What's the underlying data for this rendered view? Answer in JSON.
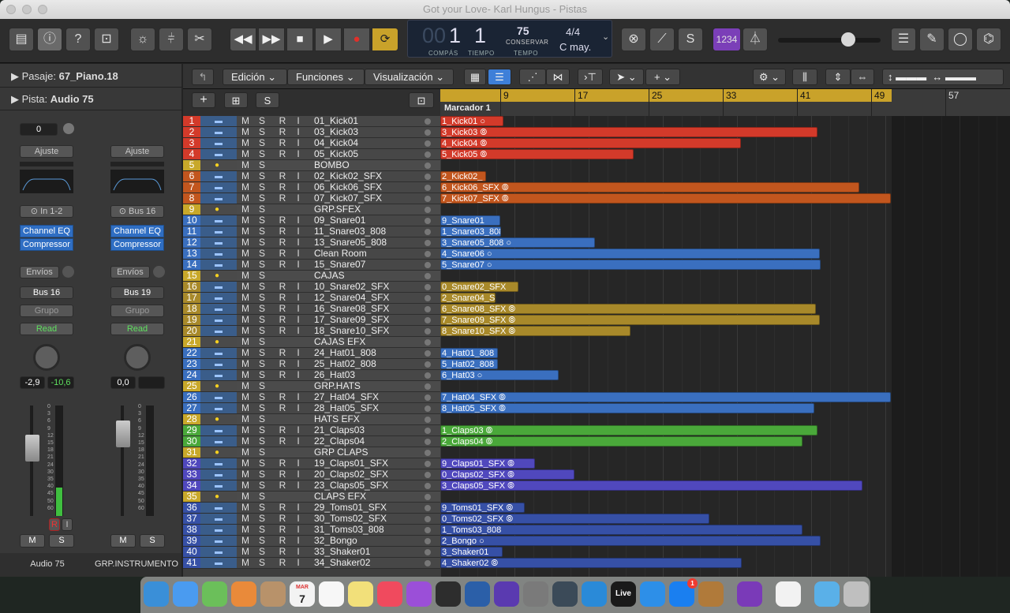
{
  "window": {
    "title": "Got your Love- Karl Hungus - Pistas"
  },
  "lcd": {
    "bar": "1",
    "beat": "1",
    "tempo": "75",
    "tempo_mode": "CONSERVAR",
    "sig": "4/4",
    "key": "C may.",
    "bar_label": "COMPÁS",
    "beat_label": "TIEMPO",
    "tempo_label": "TEMPO",
    "count_in": "1234"
  },
  "inspector": {
    "region_label": "Pasaje:",
    "region_name": "67_Piano.18",
    "track_label": "Pista:",
    "track_name": "Audio 75",
    "strip1": {
      "value": "0",
      "ajuste": "Ajuste",
      "input": "In 1-2",
      "plugin1": "Channel EQ",
      "plugin2": "Compressor",
      "envios": "Envíos",
      "bus": "Bus 16",
      "grupo": "Grupo",
      "read": "Read",
      "vol": "-2,9",
      "peak": "-10,6",
      "name": "Audio 75"
    },
    "strip2": {
      "ajuste": "Ajuste",
      "input": "Bus 16",
      "plugin1": "Channel EQ",
      "plugin2": "Compressor",
      "envios": "Envíos",
      "bus": "Bus 19",
      "grupo": "Grupo",
      "read": "Read",
      "vol": "0,0",
      "name": "GRP.INSTRUMENTO"
    },
    "meter_scale": [
      "0",
      "3",
      "6",
      "9",
      "12",
      "15",
      "18",
      "21",
      "24",
      "30",
      "35",
      "40",
      "45",
      "50",
      "60"
    ]
  },
  "menus": {
    "edit": "Edición",
    "functions": "Funciones",
    "view": "Visualización"
  },
  "ruler": {
    "marker": "Marcador 1",
    "bars": [
      "9",
      "17",
      "25",
      "33",
      "41",
      "49",
      "57"
    ]
  },
  "colors": {
    "red": "#d33a2a",
    "orange": "#c2561e",
    "blue": "#3a6fbf",
    "olive": "#a8892a",
    "green": "#4aa83a",
    "purple": "#5048bd",
    "navy": "#3650a6",
    "folder": "#c8a82a"
  },
  "tracks": [
    {
      "n": "1",
      "name": "01_Kick01",
      "c": "red",
      "r": "1_Kick01",
      "w": 80,
      "link": 1
    },
    {
      "n": "2",
      "name": "03_Kick03",
      "c": "red",
      "r": "3_Kick03",
      "w": 478,
      "link": 2
    },
    {
      "n": "3",
      "name": "04_Kick04",
      "c": "red",
      "r": "4_Kick04",
      "w": 381,
      "link": 2
    },
    {
      "n": "4",
      "name": "05_Kick05",
      "c": "red",
      "r": "5_Kick05",
      "w": 245,
      "link": 2
    },
    {
      "n": "5",
      "name": "BOMBO",
      "c": "folder",
      "folder": true
    },
    {
      "n": "6",
      "name": "02_Kick02_SFX",
      "c": "orange",
      "r": "2_Kick02_",
      "w": 58,
      "link": 0
    },
    {
      "n": "7",
      "name": "06_Kick06_SFX",
      "c": "orange",
      "r": "6_Kick06_SFX",
      "w": 531,
      "link": 2
    },
    {
      "n": "8",
      "name": "07_Kick07_SFX",
      "c": "orange",
      "r": "7_Kick07_SFX",
      "w": 571,
      "link": 2
    },
    {
      "n": "9",
      "name": "GRP.SFEX",
      "c": "folder",
      "folder": true
    },
    {
      "n": "10",
      "name": "09_Snare01",
      "c": "blue",
      "r": "9_Snare01",
      "w": 76,
      "link": 0
    },
    {
      "n": "11",
      "name": "11_Snare03_808",
      "c": "blue",
      "r": "1_Snare03_808",
      "w": 77,
      "link": 0
    },
    {
      "n": "12",
      "name": "13_Snare05_808",
      "c": "blue",
      "r": "3_Snare05_808",
      "w": 196,
      "link": 1
    },
    {
      "n": "13",
      "name": "Clean Room",
      "c": "blue",
      "r": "4_Snare06",
      "w": 481,
      "link": 1
    },
    {
      "n": "14",
      "name": "15_Snare07",
      "c": "blue",
      "r": "5_Snare07",
      "w": 482,
      "link": 1
    },
    {
      "n": "15",
      "name": "CAJAS",
      "c": "folder",
      "folder": true
    },
    {
      "n": "16",
      "name": "10_Snare02_SFX",
      "c": "olive",
      "r": "0_Snare02_SFX",
      "w": 99,
      "link": 0
    },
    {
      "n": "17",
      "name": "12_Snare04_SFX",
      "c": "olive",
      "r": "2_Snare04_S",
      "w": 70,
      "link": 0
    },
    {
      "n": "18",
      "name": "16_Snare08_SFX",
      "c": "olive",
      "r": "6_Snare08_SFX",
      "w": 476,
      "link": 2
    },
    {
      "n": "19",
      "name": "17_Snare09_SFX",
      "c": "olive",
      "r": "7_Snare09_SFX",
      "w": 481,
      "link": 2
    },
    {
      "n": "20",
      "name": "18_Snare10_SFX",
      "c": "olive",
      "r": "8_Snare10_SFX",
      "w": 241,
      "link": 2
    },
    {
      "n": "21",
      "name": "CAJAS EFX",
      "c": "folder",
      "folder": true
    },
    {
      "n": "22",
      "name": "24_Hat01_808",
      "c": "blue",
      "r": "4_Hat01_808",
      "w": 73,
      "link": 0
    },
    {
      "n": "23",
      "name": "25_Hat02_808",
      "c": "blue",
      "r": "5_Hat02_808",
      "w": 73,
      "link": 0
    },
    {
      "n": "24",
      "name": "26_Hat03",
      "c": "blue",
      "r": "6_Hat03",
      "w": 150,
      "link": 1
    },
    {
      "n": "25",
      "name": "GRP.HATS",
      "c": "folder",
      "folder": true
    },
    {
      "n": "26",
      "name": "27_Hat04_SFX",
      "c": "blue",
      "r": "7_Hat04_SFX",
      "w": 571,
      "link": 2
    },
    {
      "n": "27",
      "name": "28_Hat05_SFX",
      "c": "blue",
      "r": "8_Hat05_SFX",
      "w": 474,
      "link": 2
    },
    {
      "n": "28",
      "name": "HATS EFX",
      "c": "folder",
      "folder": true
    },
    {
      "n": "29",
      "name": "21_Claps03",
      "c": "green",
      "r": "1_Claps03",
      "w": 478,
      "link": 2
    },
    {
      "n": "30",
      "name": "22_Claps04",
      "c": "green",
      "r": "2_Claps04",
      "w": 459,
      "link": 2
    },
    {
      "n": "31",
      "name": "GRP CLAPS",
      "c": "folder",
      "folder": true
    },
    {
      "n": "32",
      "name": "19_Claps01_SFX",
      "c": "purple",
      "r": "9_Claps01_SFX",
      "w": 120,
      "link": 2
    },
    {
      "n": "33",
      "name": "20_Claps02_SFX",
      "c": "purple",
      "r": "0_Claps02_SFX",
      "w": 170,
      "link": 2
    },
    {
      "n": "34",
      "name": "23_Claps05_SFX",
      "c": "purple",
      "r": "3_Claps05_SFX",
      "w": 535,
      "link": 2
    },
    {
      "n": "35",
      "name": "CLAPS EFX",
      "c": "folder",
      "folder": true
    },
    {
      "n": "36",
      "name": "29_Toms01_SFX",
      "c": "navy",
      "r": "9_Toms01_SFX",
      "w": 107,
      "link": 2
    },
    {
      "n": "37",
      "name": "30_Toms02_SFX",
      "c": "navy",
      "r": "0_Toms02_SFX",
      "w": 341,
      "link": 2
    },
    {
      "n": "38",
      "name": "31_Toms03_808",
      "c": "navy",
      "r": "1_Toms03_808",
      "w": 459,
      "link": 0
    },
    {
      "n": "39",
      "name": "32_Bongo",
      "c": "navy",
      "r": "2_Bongo",
      "w": 482,
      "link": 1
    },
    {
      "n": "40",
      "name": "33_Shaker01",
      "c": "navy",
      "r": "3_Shaker01",
      "w": 79,
      "link": 0
    },
    {
      "n": "41",
      "name": "34_Shaker02",
      "c": "navy",
      "r": "4_Shaker02",
      "w": 382,
      "link": 2
    }
  ],
  "dock": [
    "Finder",
    "Mensajes",
    "Mapas",
    "Fotos",
    "Contactos",
    "Calendario",
    "Recordatorios",
    "Notas",
    "Música",
    "Podcasts",
    "Final Cut Pro",
    "DaVinci Resolve",
    "Motion",
    "Compressor",
    "Logic Pro",
    "MainStage",
    "Live",
    "Safari",
    "App Store",
    "GarageBand",
    "iMovie",
    "Chrome",
    "Carpeta",
    "Papelera"
  ],
  "dock_calendar": {
    "month": "MAR",
    "day": "7"
  },
  "dock_live": "Live",
  "appstore_badge": "1",
  "labels": {
    "M": "M",
    "S": "S",
    "R": "R",
    "I": "I",
    "s_button": "S"
  }
}
